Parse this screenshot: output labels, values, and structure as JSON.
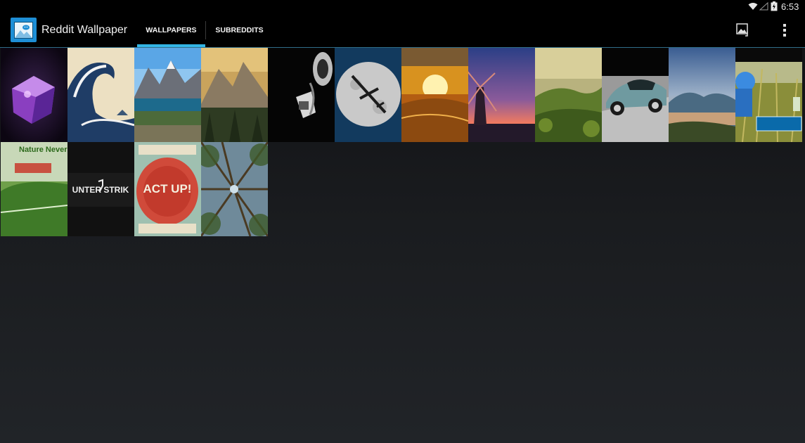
{
  "status_bar": {
    "time": "6:53",
    "icons": [
      "wifi-icon",
      "cell-signal-icon",
      "battery-charging-icon"
    ]
  },
  "action_bar": {
    "app_icon": "app-logo-icon",
    "title": "Reddit Wallpaper",
    "tabs": [
      {
        "label": "WALLPAPERS",
        "selected": true
      },
      {
        "label": "SUBREDDITS",
        "selected": false
      }
    ],
    "actions": [
      "set-wallpaper-icon",
      "overflow-menu-icon"
    ],
    "accent_color": "#33b5e5"
  },
  "wallpapers": {
    "items": [
      {
        "name": "purple-nebula-cube"
      },
      {
        "name": "great-wave-off-kanagawa"
      },
      {
        "name": "mountain-lake"
      },
      {
        "name": "golden-mountain-forest"
      },
      {
        "name": "gas-mask-soldier"
      },
      {
        "name": "plane-across-moon"
      },
      {
        "name": "sunset-over-clouds"
      },
      {
        "name": "windmill-dusk"
      },
      {
        "name": "green-valley-hills"
      },
      {
        "name": "vintage-car"
      },
      {
        "name": "mountain-fjord-dusk"
      },
      {
        "name": "pixel-art-character-in-grass"
      },
      {
        "name": "nature-never-goes-out-of-style",
        "text": "Nature Never"
      },
      {
        "name": "counter-strike-logo",
        "text": "UNTER STRIK"
      },
      {
        "name": "act-up-graffiti",
        "text": "ACT UP!"
      },
      {
        "name": "forest-canopy-looking-up"
      }
    ]
  }
}
